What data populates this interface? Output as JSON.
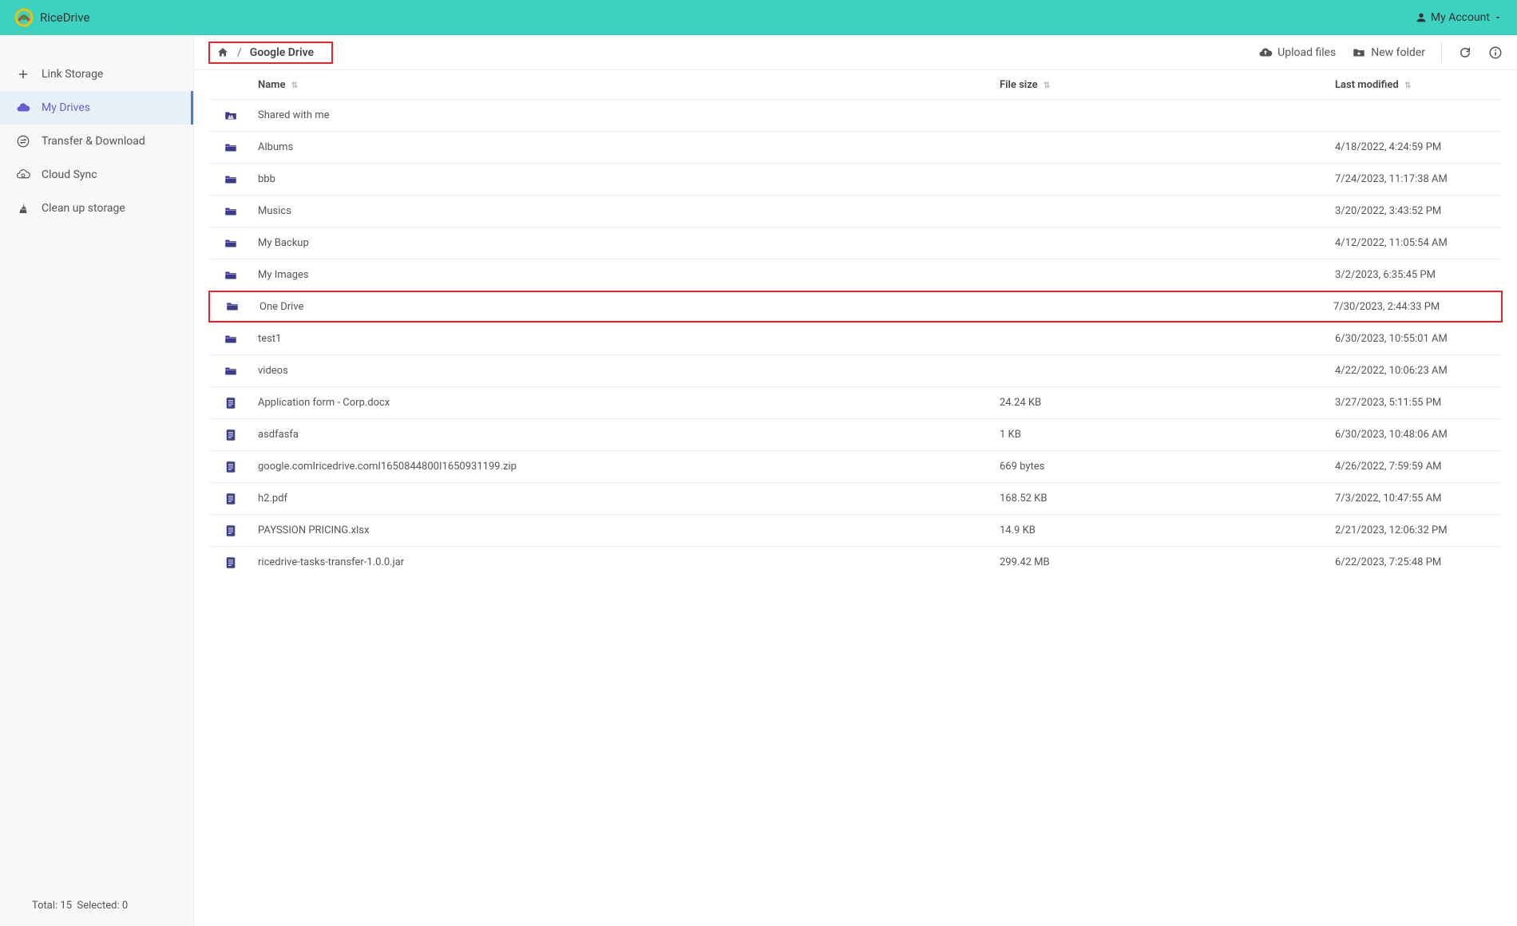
{
  "brand": {
    "name": "RiceDrive"
  },
  "account": {
    "label": "My Account"
  },
  "sidebar": {
    "items": [
      {
        "label": "Link Storage"
      },
      {
        "label": "My Drives"
      },
      {
        "label": "Transfer & Download"
      },
      {
        "label": "Cloud Sync"
      },
      {
        "label": "Clean up storage"
      }
    ]
  },
  "footer": {
    "total_label": "Total:",
    "total_value": "15",
    "selected_label": "Selected:",
    "selected_value": "0"
  },
  "breadcrumb": {
    "sep": "/",
    "current": "Google Drive"
  },
  "toolbar": {
    "upload": "Upload files",
    "newfolder": "New folder"
  },
  "columns": {
    "name": "Name",
    "size": "File size",
    "date": "Last modified",
    "sort": "⇅"
  },
  "rows": [
    {
      "kind": "shared",
      "name": "Shared with me",
      "size": "",
      "date": ""
    },
    {
      "kind": "folder",
      "name": "Albums",
      "size": "",
      "date": "4/18/2022, 4:24:59 PM"
    },
    {
      "kind": "folder",
      "name": "bbb",
      "size": "",
      "date": "7/24/2023, 11:17:38 AM"
    },
    {
      "kind": "folder",
      "name": "Musics",
      "size": "",
      "date": "3/20/2022, 3:43:52 PM"
    },
    {
      "kind": "folder",
      "name": "My Backup",
      "size": "",
      "date": "4/12/2022, 11:05:54 AM"
    },
    {
      "kind": "folder",
      "name": "My Images",
      "size": "",
      "date": "3/2/2023, 6:35:45 PM"
    },
    {
      "kind": "folder",
      "name": "One Drive",
      "size": "",
      "date": "7/30/2023, 2:44:33 PM",
      "highlight": true
    },
    {
      "kind": "folder",
      "name": "test1",
      "size": "",
      "date": "6/30/2023, 10:55:01 AM"
    },
    {
      "kind": "folder",
      "name": "videos",
      "size": "",
      "date": "4/22/2022, 10:06:23 AM"
    },
    {
      "kind": "file",
      "name": "Application form - Corp.docx",
      "size": "24.24 KB",
      "date": "3/27/2023, 5:11:55 PM"
    },
    {
      "kind": "file",
      "name": "asdfasfa",
      "size": "1 KB",
      "date": "6/30/2023, 10:48:06 AM"
    },
    {
      "kind": "file",
      "name": "google.comIricedrive.comI1650844800I1650931199.zip",
      "size": "669 bytes",
      "date": "4/26/2022, 7:59:59 AM"
    },
    {
      "kind": "file",
      "name": "h2.pdf",
      "size": "168.52 KB",
      "date": "7/3/2022, 10:47:55 AM"
    },
    {
      "kind": "file",
      "name": "PAYSSION PRICING.xlsx",
      "size": "14.9 KB",
      "date": "2/21/2023, 12:06:32 PM"
    },
    {
      "kind": "file",
      "name": "ricedrive-tasks-transfer-1.0.0.jar",
      "size": "299.42 MB",
      "date": "6/22/2023, 7:25:48 PM"
    }
  ]
}
